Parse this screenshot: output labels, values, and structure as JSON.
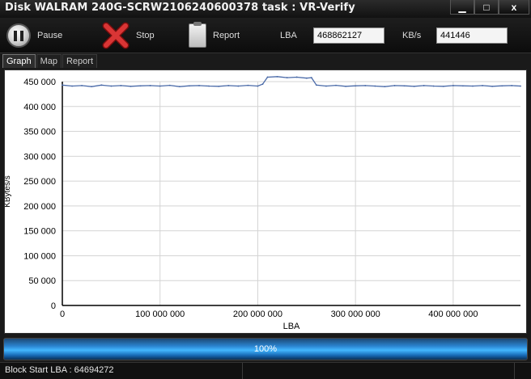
{
  "window": {
    "title": "Disk WALRAM 240G-SCRW2106240600378   task : VR-Verify",
    "minimize_glyph": "▁",
    "maximize_glyph": "□",
    "close_glyph": "x"
  },
  "toolbar": {
    "pause_label": "Pause",
    "pause_icon": "pause-icon",
    "stop_label": "Stop",
    "stop_icon": "red-x-icon",
    "report_label": "Report",
    "report_icon": "clipboard-icon",
    "lba_label": "LBA",
    "lba_value": "468862127",
    "kbs_label": "KB/s",
    "kbs_value": "441446"
  },
  "tabs": [
    {
      "label": "Graph",
      "active": true
    },
    {
      "label": "Map",
      "active": false
    },
    {
      "label": "Report",
      "active": false
    }
  ],
  "progress": {
    "label": "100%",
    "percent": 100
  },
  "status": {
    "block_start": "Block Start LBA : 64694272"
  },
  "colors": {
    "series": "#4a6aa8",
    "grid": "#d4d4d4",
    "progress_glow": "#3cb4ff"
  },
  "chart_data": {
    "type": "line",
    "xlabel": "LBA",
    "ylabel": "KBytes/s",
    "xlim": [
      0,
      468862127
    ],
    "ylim": [
      0,
      450000
    ],
    "x_ticks": [
      0,
      100000000,
      200000000,
      300000000,
      400000000
    ],
    "x_tick_labels": [
      "0",
      "100 000 000",
      "200 000 000",
      "300 000 000",
      "400 000 000"
    ],
    "y_ticks": [
      0,
      50000,
      100000,
      150000,
      200000,
      250000,
      300000,
      350000,
      400000,
      450000
    ],
    "y_tick_labels": [
      "0",
      "50 000",
      "100 000",
      "150 000",
      "200 000",
      "250 000",
      "300 000",
      "350 000",
      "400 000",
      "450 000"
    ],
    "grid": true,
    "series": [
      {
        "values_x": [
          0,
          10000000,
          20000000,
          30000000,
          40000000,
          50000000,
          60000000,
          70000000,
          80000000,
          90000000,
          100000000,
          110000000,
          120000000,
          130000000,
          140000000,
          150000000,
          160000000,
          170000000,
          180000000,
          190000000,
          200000000,
          205000000,
          210000000,
          220000000,
          230000000,
          240000000,
          250000000,
          255000000,
          260000000,
          270000000,
          280000000,
          290000000,
          300000000,
          310000000,
          320000000,
          330000000,
          340000000,
          350000000,
          360000000,
          370000000,
          380000000,
          390000000,
          400000000,
          410000000,
          420000000,
          430000000,
          440000000,
          450000000,
          460000000,
          468862127
        ],
        "values_y": [
          443000,
          441000,
          442000,
          440000,
          443000,
          441000,
          442000,
          440500,
          441500,
          442000,
          441000,
          442500,
          440000,
          441500,
          442000,
          441000,
          440500,
          442000,
          441000,
          442500,
          441000,
          445000,
          459000,
          460000,
          458000,
          459000,
          457000,
          458000,
          443000,
          441000,
          442500,
          440500,
          441500,
          442000,
          441000,
          440000,
          442000,
          441500,
          440500,
          442000,
          441000,
          440500,
          442000,
          441500,
          441000,
          442000,
          440500,
          441500,
          442000,
          441000
        ]
      }
    ]
  }
}
